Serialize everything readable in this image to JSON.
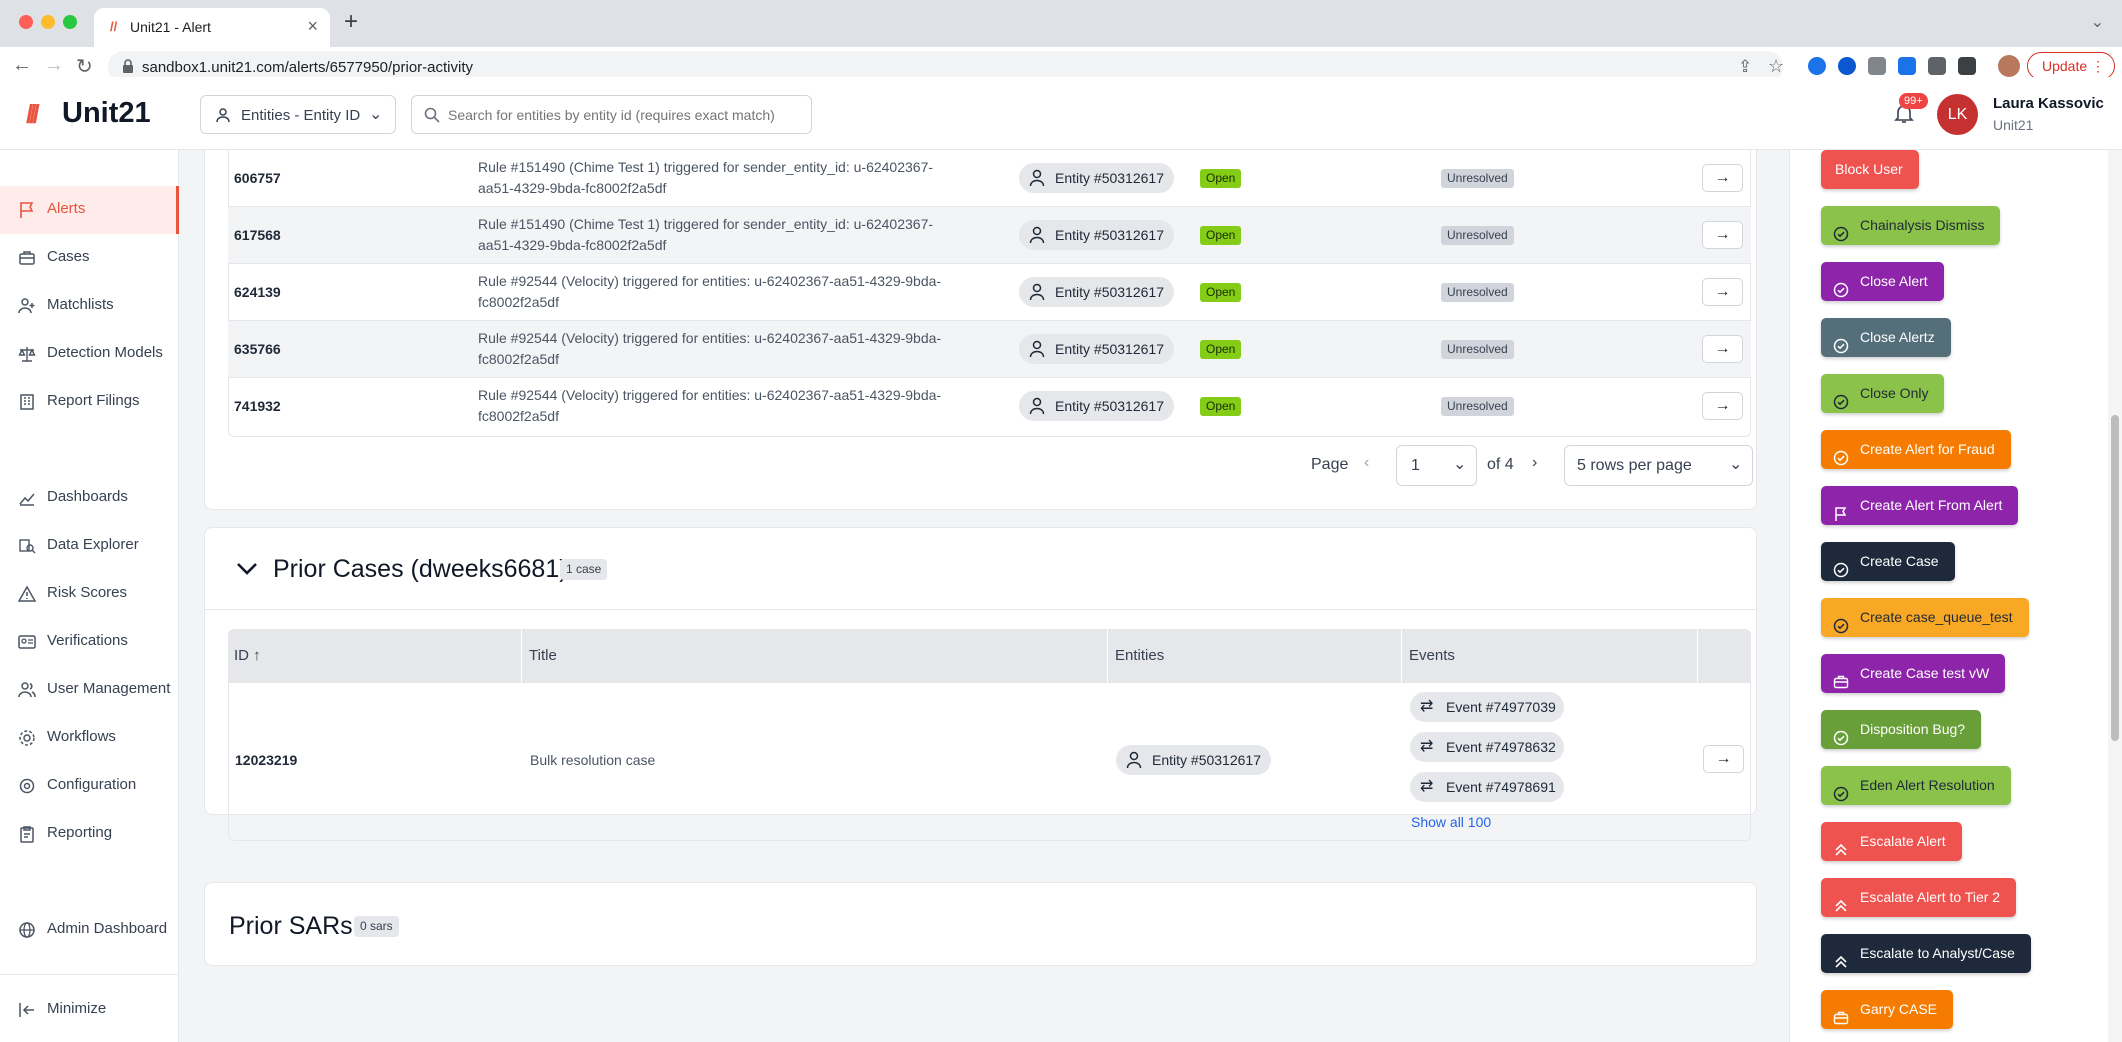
{
  "browser": {
    "tab_title": "Unit21 - Alert",
    "url": "sandbox1.unit21.com/alerts/6577950/prior-activity",
    "update_label": "Update"
  },
  "header": {
    "logo_text": "Unit21",
    "entity_select": "Entities - Entity ID",
    "search_placeholder": "Search for entities by entity id (requires exact match)",
    "notifications_badge": "99+",
    "user_initials": "LK",
    "user_name": "Laura Kassovic",
    "user_org": "Unit21"
  },
  "sidebar": {
    "items": [
      {
        "label": "Alerts",
        "icon": "flag-icon"
      },
      {
        "label": "Cases",
        "icon": "briefcase-icon"
      },
      {
        "label": "Matchlists",
        "icon": "user-plus-icon"
      },
      {
        "label": "Detection Models",
        "icon": "scale-icon"
      },
      {
        "label": "Report Filings",
        "icon": "building-icon"
      },
      {
        "label": "Dashboards",
        "icon": "chart-line-icon"
      },
      {
        "label": "Data Explorer",
        "icon": "search-data-icon"
      },
      {
        "label": "Risk Scores",
        "icon": "warning-icon"
      },
      {
        "label": "Verifications",
        "icon": "id-card-icon"
      },
      {
        "label": "User Management",
        "icon": "users-icon"
      },
      {
        "label": "Workflows",
        "icon": "cog-flow-icon"
      },
      {
        "label": "Configuration",
        "icon": "gear-icon"
      },
      {
        "label": "Reporting",
        "icon": "clipboard-icon"
      },
      {
        "label": "Admin Dashboard",
        "icon": "globe-icon"
      }
    ],
    "minimize_label": "Minimize"
  },
  "prior_alerts": {
    "rows": [
      {
        "id": "606757",
        "title": "Rule #151490 (Chime Test 1) triggered for sender_entity_id: u-62402367-aa51-4329-9bda-fc8002f2a5df",
        "entity": "Entity #50312617",
        "status": "Open",
        "disposition": "Unresolved"
      },
      {
        "id": "617568",
        "title": "Rule #151490 (Chime Test 1) triggered for sender_entity_id: u-62402367-aa51-4329-9bda-fc8002f2a5df",
        "entity": "Entity #50312617",
        "status": "Open",
        "disposition": "Unresolved"
      },
      {
        "id": "624139",
        "title": "Rule #92544 (Velocity) triggered for entities: u-62402367-aa51-4329-9bda-fc8002f2a5df",
        "entity": "Entity #50312617",
        "status": "Open",
        "disposition": "Unresolved"
      },
      {
        "id": "635766",
        "title": "Rule #92544 (Velocity) triggered for entities: u-62402367-aa51-4329-9bda-fc8002f2a5df",
        "entity": "Entity #50312617",
        "status": "Open",
        "disposition": "Unresolved"
      },
      {
        "id": "741932",
        "title": "Rule #92544 (Velocity) triggered for entities: u-62402367-aa51-4329-9bda-fc8002f2a5df",
        "entity": "Entity #50312617",
        "status": "Open",
        "disposition": "Unresolved"
      }
    ],
    "pager": {
      "page_label": "Page",
      "page_value": "1",
      "of_label": "of 4",
      "rows_per_page": "5 rows per page"
    }
  },
  "prior_cases": {
    "title": "Prior Cases (dweeks6681)",
    "count": "1 case",
    "columns": [
      "ID",
      "Title",
      "Entities",
      "Events"
    ],
    "row": {
      "id": "12023219",
      "title": "Bulk resolution case",
      "entity": "Entity #50312617",
      "events": [
        "Event #74977039",
        "Event #74978632",
        "Event #74978691"
      ],
      "show_all": "Show all 100"
    }
  },
  "prior_sars": {
    "title": "Prior SARs",
    "count": "0 sars"
  },
  "actions": [
    {
      "label": "Block User",
      "color": "#ef5350",
      "icon": ""
    },
    {
      "label": "Chainalysis Dismiss",
      "color": "#8bc34a",
      "icon": "check-circle-icon"
    },
    {
      "label": "Close Alert",
      "color": "#8e24aa",
      "icon": "check-circle-icon"
    },
    {
      "label": "Close Alertz",
      "color": "#546e7a",
      "icon": "check-circle-icon"
    },
    {
      "label": "Close Only",
      "color": "#8bc34a",
      "icon": "check-circle-icon"
    },
    {
      "label": "Create Alert for Fraud",
      "color": "#f57c00",
      "icon": "check-circle-icon"
    },
    {
      "label": "Create Alert From Alert",
      "color": "#8e24aa",
      "icon": "flag-icon"
    },
    {
      "label": "Create Case",
      "color": "#1e293b",
      "icon": "check-circle-icon"
    },
    {
      "label": "Create case_queue_test",
      "color": "#f9a825",
      "icon": "check-circle-icon"
    },
    {
      "label": "Create Case test vW",
      "color": "#8e24aa",
      "icon": "briefcase-icon"
    },
    {
      "label": "Disposition Bug?",
      "color": "#689f38",
      "icon": "check-circle-icon"
    },
    {
      "label": "Eden Alert Resolution",
      "color": "#8bc34a",
      "icon": "check-circle-icon"
    },
    {
      "label": "Escalate Alert",
      "color": "#ef5350",
      "icon": "double-chevron-up-icon"
    },
    {
      "label": "Escalate Alert to Tier 2",
      "color": "#ef5350",
      "icon": "double-chevron-up-icon"
    },
    {
      "label": "Escalate to Analyst/Case",
      "color": "#1e293b",
      "icon": "double-chevron-up-icon"
    },
    {
      "label": "Garry CASE",
      "color": "#f57c00",
      "icon": "briefcase-icon"
    }
  ]
}
